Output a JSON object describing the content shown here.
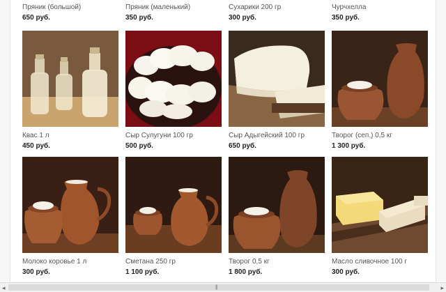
{
  "products": [
    {
      "name": "Пряник (большой)",
      "price": "650 руб.",
      "image": "gingerbread-large"
    },
    {
      "name": "Пряник (маленький)",
      "price": "350 руб.",
      "image": "gingerbread-small"
    },
    {
      "name": "Сухарики 200 гр",
      "price": "300 руб.",
      "image": "croutons"
    },
    {
      "name": "Чурчхелла",
      "price": "350 руб.",
      "image": "churchkhela"
    },
    {
      "name": "Квас 1 л",
      "price": "450 руб.",
      "image": "kvass-bottles"
    },
    {
      "name": "Сыр Сулугуни 100 гр",
      "price": "500 руб.",
      "image": "suluguni-cheese"
    },
    {
      "name": "Сыр Адыгейский 100 гр",
      "price": "650 руб.",
      "image": "adyghe-cheese"
    },
    {
      "name": "Творог (сеп.) 0,5 кг",
      "price": "1 300 руб.",
      "image": "cottage-cheese-pots"
    },
    {
      "name": "Молоко коровье 1 л",
      "price": "300 руб.",
      "image": "milk-jug"
    },
    {
      "name": "Сметана 250 гр",
      "price": "1 100 руб.",
      "image": "sour-cream-jug"
    },
    {
      "name": "Творог 0,5 кг",
      "price": "1 800 руб.",
      "image": "cottage-cheese-jars"
    },
    {
      "name": "Масло сливочное 100 г",
      "price": "300 руб.",
      "image": "butter"
    }
  ],
  "scrollbar": {
    "left_icon": "scroll-left-arrow-icon",
    "right_icon": "scroll-right-arrow-icon",
    "grip": "|||"
  }
}
